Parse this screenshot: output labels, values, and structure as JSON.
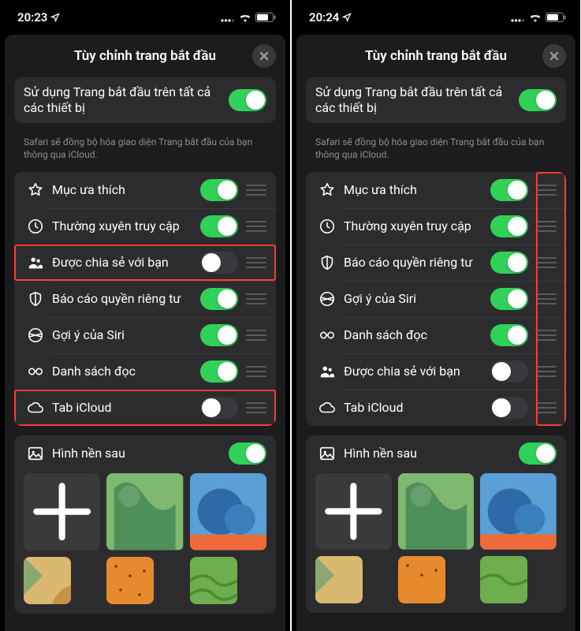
{
  "left": {
    "time": "20:23",
    "title": "Tùy chỉnh trang bắt đầu",
    "sync": {
      "label": "Sử dụng Trang bắt đầu trên tất cả các thiết bị",
      "on": true
    },
    "sync_note": "Safari sẽ đồng bộ hóa giao diện Trang bắt đầu của bạn thông qua iCloud.",
    "items": [
      {
        "icon": "star",
        "label": "Mục ưa thích",
        "on": true
      },
      {
        "icon": "clock",
        "label": "Thường xuyên truy cập",
        "on": true
      },
      {
        "icon": "people",
        "label": "Được chia sẻ với bạn",
        "on": false
      },
      {
        "icon": "shield",
        "label": "Báo cáo quyền riêng tư",
        "on": true
      },
      {
        "icon": "siri",
        "label": "Gợi ý của Siri",
        "on": true
      },
      {
        "icon": "glasses",
        "label": "Danh sách đọc",
        "on": true
      },
      {
        "icon": "cloud",
        "label": "Tab iCloud",
        "on": false
      }
    ],
    "wallpaper": {
      "label": "Hình nền sau",
      "on": true
    }
  },
  "right": {
    "time": "20:24",
    "title": "Tùy chỉnh trang bắt đầu",
    "sync": {
      "label": "Sử dụng Trang bắt đầu trên tất cả các thiết bị",
      "on": true
    },
    "sync_note": "Safari sẽ đồng bộ hóa giao diện Trang bắt đầu của bạn thông qua iCloud.",
    "items": [
      {
        "icon": "star",
        "label": "Mục ưa thích",
        "on": true
      },
      {
        "icon": "clock",
        "label": "Thường xuyên truy cập",
        "on": true
      },
      {
        "icon": "shield",
        "label": "Báo cáo quyền riêng tư",
        "on": true
      },
      {
        "icon": "siri",
        "label": "Gợi ý của Siri",
        "on": true
      },
      {
        "icon": "glasses",
        "label": "Danh sách đọc",
        "on": true
      },
      {
        "icon": "people",
        "label": "Được chia sẻ với bạn",
        "on": false
      },
      {
        "icon": "cloud",
        "label": "Tab iCloud",
        "on": false
      }
    ],
    "wallpaper": {
      "label": "Hình nền sau",
      "on": true
    }
  }
}
